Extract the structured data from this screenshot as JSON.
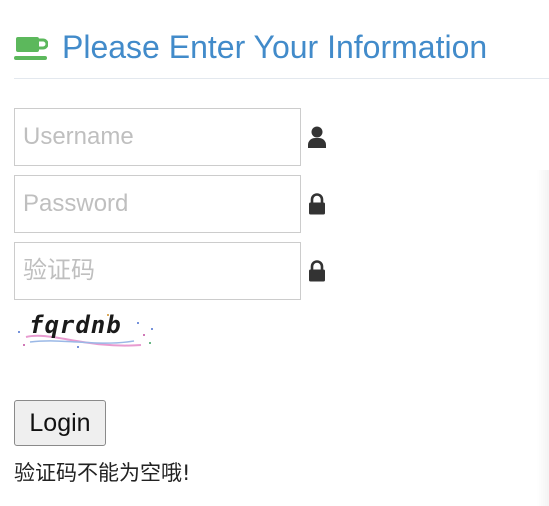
{
  "header": {
    "title": "Please Enter Your Information",
    "icon": "coffee-cup-icon",
    "accent_color": "#428bca",
    "icon_color": "#5cb85c"
  },
  "form": {
    "username": {
      "placeholder": "Username",
      "value": "",
      "icon": "user-icon"
    },
    "password": {
      "placeholder": "Password",
      "value": "",
      "icon": "lock-icon"
    },
    "captcha_input": {
      "placeholder": "验证码",
      "value": "",
      "icon": "lock-icon"
    },
    "captcha_image_text": "fqrdnb",
    "login_label": "Login"
  },
  "message": "验证码不能为空哦!"
}
